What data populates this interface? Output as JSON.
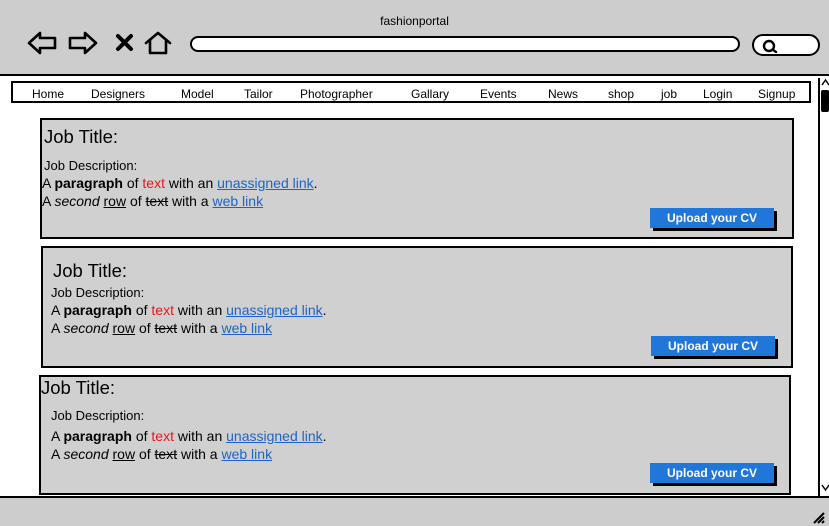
{
  "window": {
    "title": "fashionportal"
  },
  "toolbar": {
    "icons": [
      "back-arrow-icon",
      "forward-arrow-icon",
      "close-icon",
      "home-icon",
      "search-icon"
    ],
    "address_value": ""
  },
  "menu": {
    "items": [
      "Home",
      "Designers",
      "Model",
      "Tailor",
      "Photographer",
      "Gallary",
      "Events",
      "News",
      "shop",
      "job",
      "Login",
      "Signup"
    ]
  },
  "jobs": [
    {
      "title": "Job Title:",
      "description_label": "Job Description:",
      "line1": {
        "a": "A",
        "paragraph": "paragraph",
        "of": "of",
        "text": "text",
        "with_an": "with an",
        "link": "unassigned link",
        "end": "."
      },
      "line2": {
        "a": "A",
        "second": "second",
        "row": "row",
        "of": "of",
        "text": "text",
        "with_a": "with a",
        "link": "web link"
      },
      "button": "Upload your CV"
    },
    {
      "title": "Job Title:",
      "description_label": "Job Description:",
      "line1": {
        "a": "A",
        "paragraph": "paragraph",
        "of": "of",
        "text": "text",
        "with_an": "with an",
        "link": "unassigned link",
        "end": "."
      },
      "line2": {
        "a": "A",
        "second": "second",
        "row": "row",
        "of": "of",
        "text": "text",
        "with_a": "with a",
        "link": "web link"
      },
      "button": "Upload your CV"
    },
    {
      "title": "Job Title:",
      "description_label": "Job Description:",
      "line1": {
        "a": "A",
        "paragraph": "paragraph",
        "of": "of",
        "text": "text",
        "with_an": "with an",
        "link": "unassigned link",
        "end": "."
      },
      "line2": {
        "a": "A",
        "second": "second",
        "row": "row",
        "of": "of",
        "text": "text",
        "with_a": "with a",
        "link": "web link"
      },
      "button": "Upload your CV"
    }
  ],
  "colors": {
    "chrome": "#cdcdcd",
    "card": "#d0d0d0",
    "accent_button": "#2176d9",
    "link": "#1f63c6",
    "red_text": "#e4191c"
  }
}
